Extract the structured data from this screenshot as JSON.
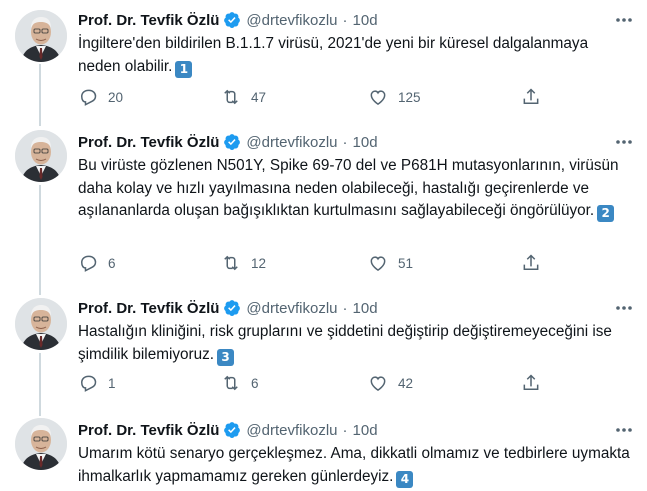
{
  "tweets": [
    {
      "name": "Prof. Dr. Tevfik Özlü",
      "handle": "@drtevfikozlu",
      "separator": "·",
      "time": "10d",
      "text": "İngiltere'den bildirilen B.1.1.7 virüsü, 2021'de yeni bir küresel dalgalanmaya neden olabilir.",
      "number_emoji": "1",
      "replies": "20",
      "retweets": "47",
      "likes": "125"
    },
    {
      "name": "Prof. Dr. Tevfik Özlü",
      "handle": "@drtevfikozlu",
      "separator": "·",
      "time": "10d",
      "text": "Bu virüste gözlenen N501Y, Spike 69-70 del ve P681H mutasyonlarının, virüsün daha kolay ve hızlı yayılmasına neden olabileceği, hastalığı geçirenlerde ve aşılananlarda oluşan bağışıklıktan kurtulmasını sağlayabileceği öngörülüyor.",
      "number_emoji": "2",
      "replies": "6",
      "retweets": "12",
      "likes": "51"
    },
    {
      "name": "Prof. Dr. Tevfik Özlü",
      "handle": "@drtevfikozlu",
      "separator": "·",
      "time": "10d",
      "text": "Hastalığın kliniğini, risk gruplarını ve şiddetini değiştirip değiştiremeyeceğini ise şimdilik bilemiyoruz.",
      "number_emoji": "3",
      "replies": "1",
      "retweets": "6",
      "likes": "42"
    },
    {
      "name": "Prof. Dr. Tevfik Özlü",
      "handle": "@drtevfikozlu",
      "separator": "·",
      "time": "10d",
      "text": "Umarım kötü senaryo gerçekleşmez. Ama, dikkatli olmamız ve tedbirlere uymakta ihmalkarlık yapmamamız gereken günlerdeyiz.",
      "number_emoji": "4"
    }
  ],
  "icons": {
    "verified": "verified-badge-icon",
    "more": "more-icon",
    "reply": "reply-icon",
    "retweet": "retweet-icon",
    "like": "heart-icon",
    "share": "share-icon"
  },
  "colors": {
    "text": "#0f1419",
    "secondary": "#536471",
    "verified": "#1d9bf0",
    "thread_line": "#cfd9de",
    "keycap": "#3b88c3"
  }
}
